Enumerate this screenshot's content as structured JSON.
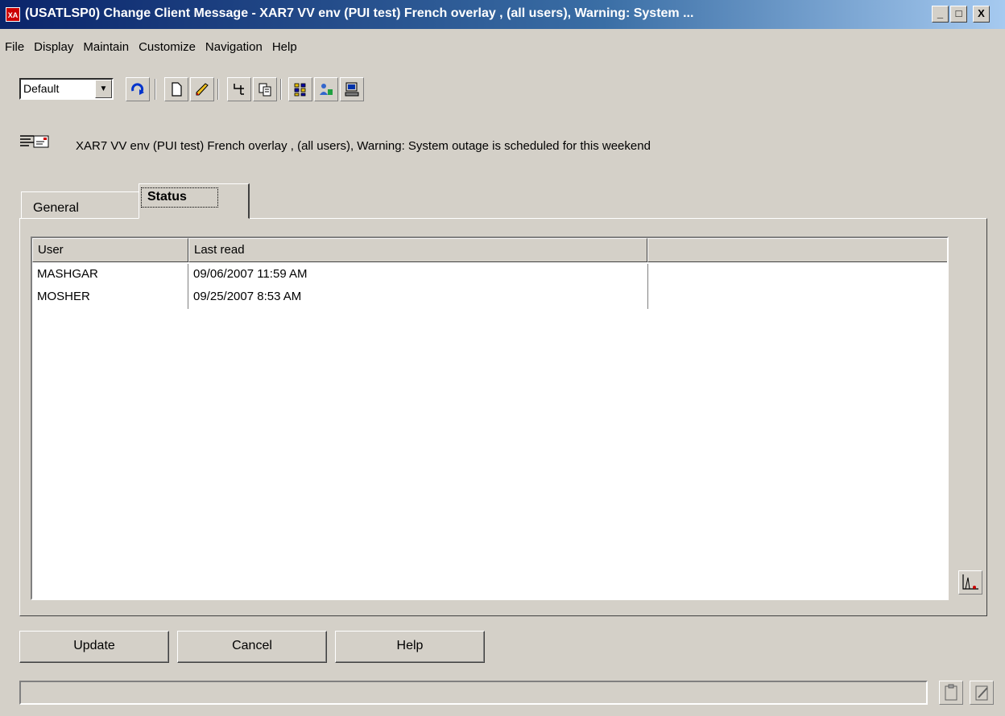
{
  "window": {
    "app_icon_text": "XA",
    "title": "(USATLSP0) Change Client Message - XAR7 VV env (PUI test) French overlay   , (all users), Warning: System ...",
    "controls": {
      "minimize": "_",
      "maximize": "□",
      "close": "X"
    }
  },
  "menu": [
    "File",
    "Display",
    "Maintain",
    "Customize",
    "Navigation",
    "Help"
  ],
  "toolbar": {
    "view_select_value": "Default",
    "buttons": [
      "refresh-icon",
      "new-document-icon",
      "edit-pencil-icon",
      "tree-icon",
      "copy-icon",
      "grid-icon",
      "user-network-icon",
      "computer-icon"
    ]
  },
  "message": {
    "icon": "message-list-icon",
    "text": "XAR7 VV env (PUI test) French overlay   , (all users), Warning: System outage is scheduled for this weekend"
  },
  "tabs": [
    "General",
    "Status"
  ],
  "active_tab": "Status",
  "list": {
    "columns": [
      "User",
      "Last read"
    ],
    "rows": [
      {
        "user": "MASHGAR",
        "last_read": "09/06/2007 11:59 AM"
      },
      {
        "user": "MOSHER",
        "last_read": "09/25/2007 8:53 AM"
      }
    ]
  },
  "buttons": {
    "update": "Update",
    "cancel": "Cancel",
    "help": "Help"
  },
  "status_bar": {
    "text": "",
    "icons": [
      "clipboard-icon",
      "edit-document-icon"
    ]
  },
  "colors": {
    "titlebar_start": "#0a246a",
    "titlebar_end": "#a6caf0",
    "face": "#d4d0c8"
  }
}
